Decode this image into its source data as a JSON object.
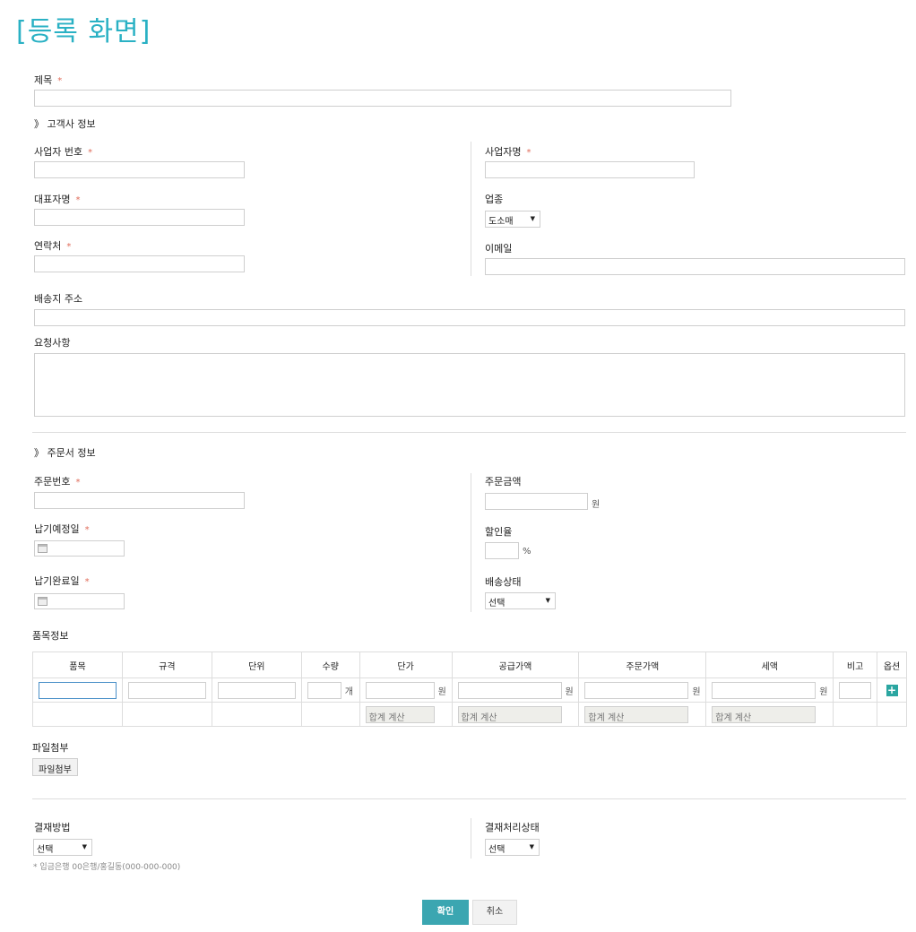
{
  "page_title": "[등록 화면]",
  "required_mark": "*",
  "title_field": {
    "label": "제목"
  },
  "customer_section": {
    "heading": "》 고객사 정보",
    "business_number_label": "사업자 번호",
    "business_name_label": "사업자명",
    "ceo_name_label": "대표자명",
    "industry_label": "업종",
    "industry_value": "도소매",
    "contact_label": "연락처",
    "email_label": "이메일",
    "address_label": "배송지 주소",
    "request_label": "요청사항"
  },
  "order_section": {
    "heading": "》 주문서 정보",
    "order_number_label": "주문번호",
    "order_amount_label": "주문금액",
    "won_unit": "원",
    "due_date_label": "납기예정일",
    "discount_label": "할인율",
    "percent_unit": "%",
    "complete_date_label": "납기완료일",
    "shipping_status_label": "배송상태",
    "shipping_status_value": "선택"
  },
  "items": {
    "heading": "품목정보",
    "columns": [
      "품목",
      "규격",
      "단위",
      "수량",
      "단가",
      "공급가액",
      "주문가액",
      "세액",
      "비고",
      "옵션"
    ],
    "qty_unit": "개",
    "won_unit": "원",
    "calc_placeholder": "합계 계산",
    "add_icon": "plus-icon"
  },
  "attachment": {
    "label": "파일첨부",
    "button_label": "파일첨부"
  },
  "payment": {
    "method_label": "결재방법",
    "method_value": "선택",
    "status_label": "결재처리상태",
    "status_value": "선택",
    "note": "* 입금은행 00은행/홍길동(000-000-000)"
  },
  "actions": {
    "confirm_label": "확인",
    "cancel_label": "취소"
  }
}
